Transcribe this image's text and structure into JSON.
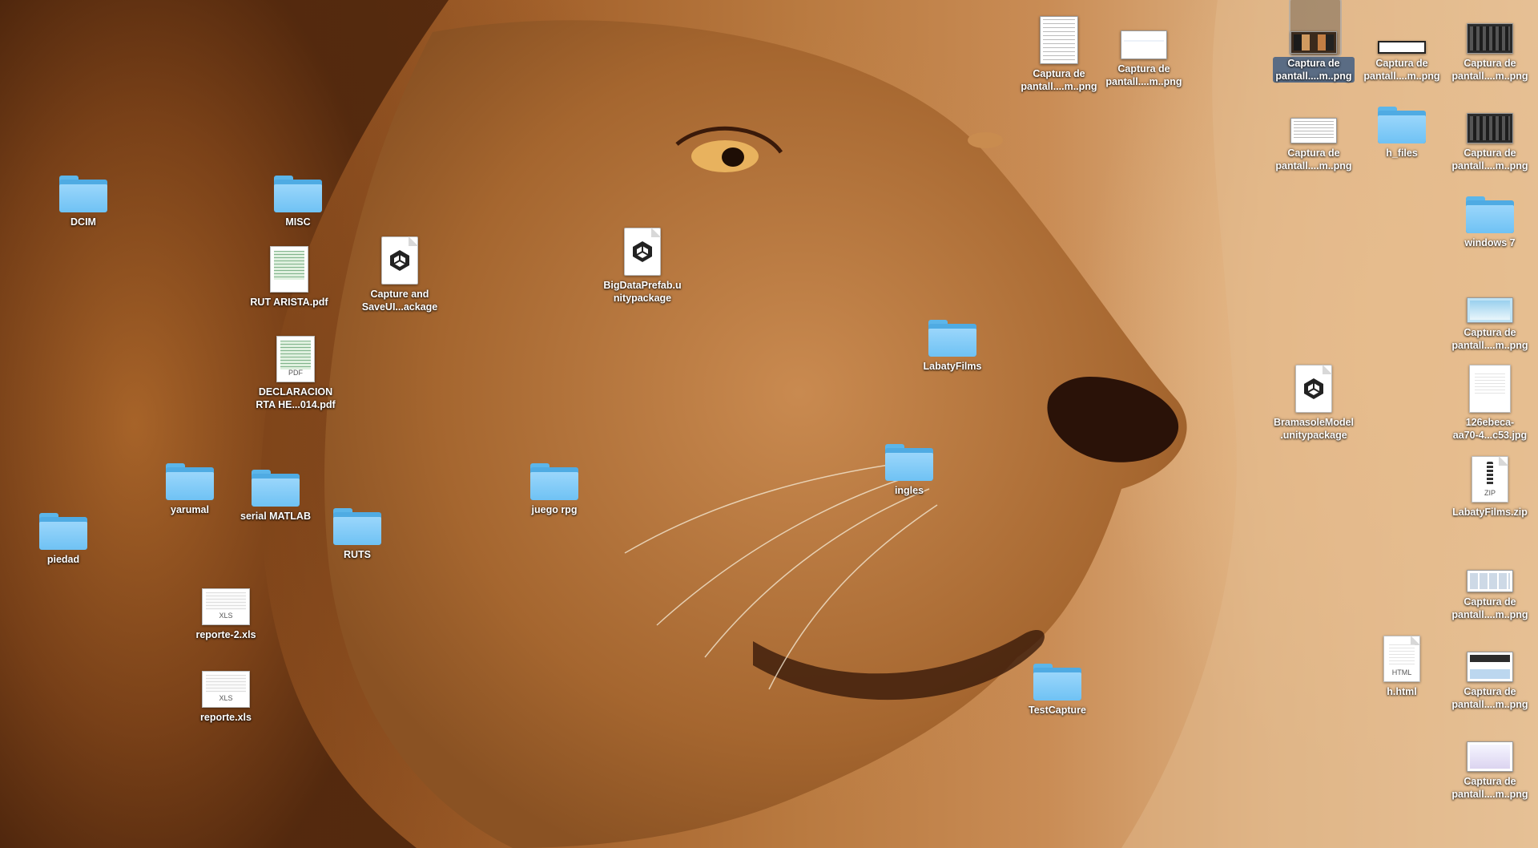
{
  "desktop": {
    "wallpaper": "lion",
    "accent_selection": "#5a6c84",
    "folder_color": "#6fc2f4",
    "items": [
      {
        "id": "cap1",
        "label": "Captura de\npantall....m..png",
        "icon": "screenshot-thumbnail-icon",
        "selected": true
      },
      {
        "id": "cap2",
        "label": "Captura de\npantall....m..png",
        "icon": "screenshot-thumbnail-icon"
      },
      {
        "id": "cap3",
        "label": "Captura de\npantall....m..png",
        "icon": "screenshot-thumbnail-icon"
      },
      {
        "id": "cap4",
        "label": "Captura de\npantall....m..png",
        "icon": "screenshot-thumbnail-icon"
      },
      {
        "id": "cap5",
        "label": "Captura de\npantall....m..png",
        "icon": "screenshot-thumbnail-icon"
      },
      {
        "id": "cap6",
        "label": "Captura de\npantall....m..png",
        "icon": "screenshot-thumbnail-icon"
      },
      {
        "id": "cap7",
        "label": "Captura de\npantall....m..png",
        "icon": "screenshot-thumbnail-icon"
      },
      {
        "id": "cap8",
        "label": "Captura de\npantall....m..png",
        "icon": "screenshot-thumbnail-icon"
      },
      {
        "id": "cap9",
        "label": "Captura de\npantall....m..png",
        "icon": "screenshot-thumbnail-icon"
      },
      {
        "id": "cap10",
        "label": "Captura de\npantall....m..png",
        "icon": "screenshot-thumbnail-icon"
      },
      {
        "id": "cap11",
        "label": "Captura de\npantall....m..png",
        "icon": "screenshot-thumbnail-icon"
      },
      {
        "id": "h_files",
        "label": "h_files",
        "icon": "folder-icon"
      },
      {
        "id": "windows7",
        "label": "windows 7",
        "icon": "folder-icon"
      },
      {
        "id": "jpg",
        "label": "126ebeca-\naa70-4...c53.jpg",
        "icon": "image-file-icon"
      },
      {
        "id": "zip",
        "label": "LabatyFilms.zip",
        "icon": "zip-file-icon"
      },
      {
        "id": "html",
        "label": "h.html",
        "icon": "html-file-icon"
      },
      {
        "id": "bramasole",
        "label": "BramasoleModel\n.unitypackage",
        "icon": "unity-package-icon"
      },
      {
        "id": "labaty",
        "label": "LabatyFilms",
        "icon": "folder-icon"
      },
      {
        "id": "ingles",
        "label": "ingles",
        "icon": "folder-icon"
      },
      {
        "id": "testcapture",
        "label": "TestCapture",
        "icon": "folder-icon"
      },
      {
        "id": "bigdata",
        "label": "BigDataPrefab.u\nnitypackage",
        "icon": "unity-package-icon"
      },
      {
        "id": "captureandsave",
        "label": "Capture and\nSaveUI...ackage",
        "icon": "unity-package-icon"
      },
      {
        "id": "dcim",
        "label": "DCIM",
        "icon": "folder-icon"
      },
      {
        "id": "misc",
        "label": "MISC",
        "icon": "folder-icon"
      },
      {
        "id": "rut",
        "label": "RUT ARISTA.pdf",
        "icon": "pdf-file-icon"
      },
      {
        "id": "declaracion",
        "label": "DECLARACION\nRTA HE...014.pdf",
        "icon": "pdf-file-icon",
        "ext": "PDF"
      },
      {
        "id": "yarumal",
        "label": "yarumal",
        "icon": "folder-icon"
      },
      {
        "id": "serial",
        "label": "serial MATLAB",
        "icon": "folder-icon"
      },
      {
        "id": "ruts",
        "label": "RUTS",
        "icon": "folder-icon"
      },
      {
        "id": "piedad",
        "label": "piedad",
        "icon": "folder-icon"
      },
      {
        "id": "juego",
        "label": "juego rpg",
        "icon": "folder-icon"
      },
      {
        "id": "reporte2",
        "label": "reporte-2.xls",
        "icon": "xls-file-icon",
        "ext": "XLS"
      },
      {
        "id": "reporte",
        "label": "reporte.xls",
        "icon": "xls-file-icon",
        "ext": "XLS"
      }
    ],
    "ext_labels": {
      "zip": "ZIP",
      "html": "HTML",
      "pdf": "PDF",
      "xls": "XLS"
    }
  }
}
